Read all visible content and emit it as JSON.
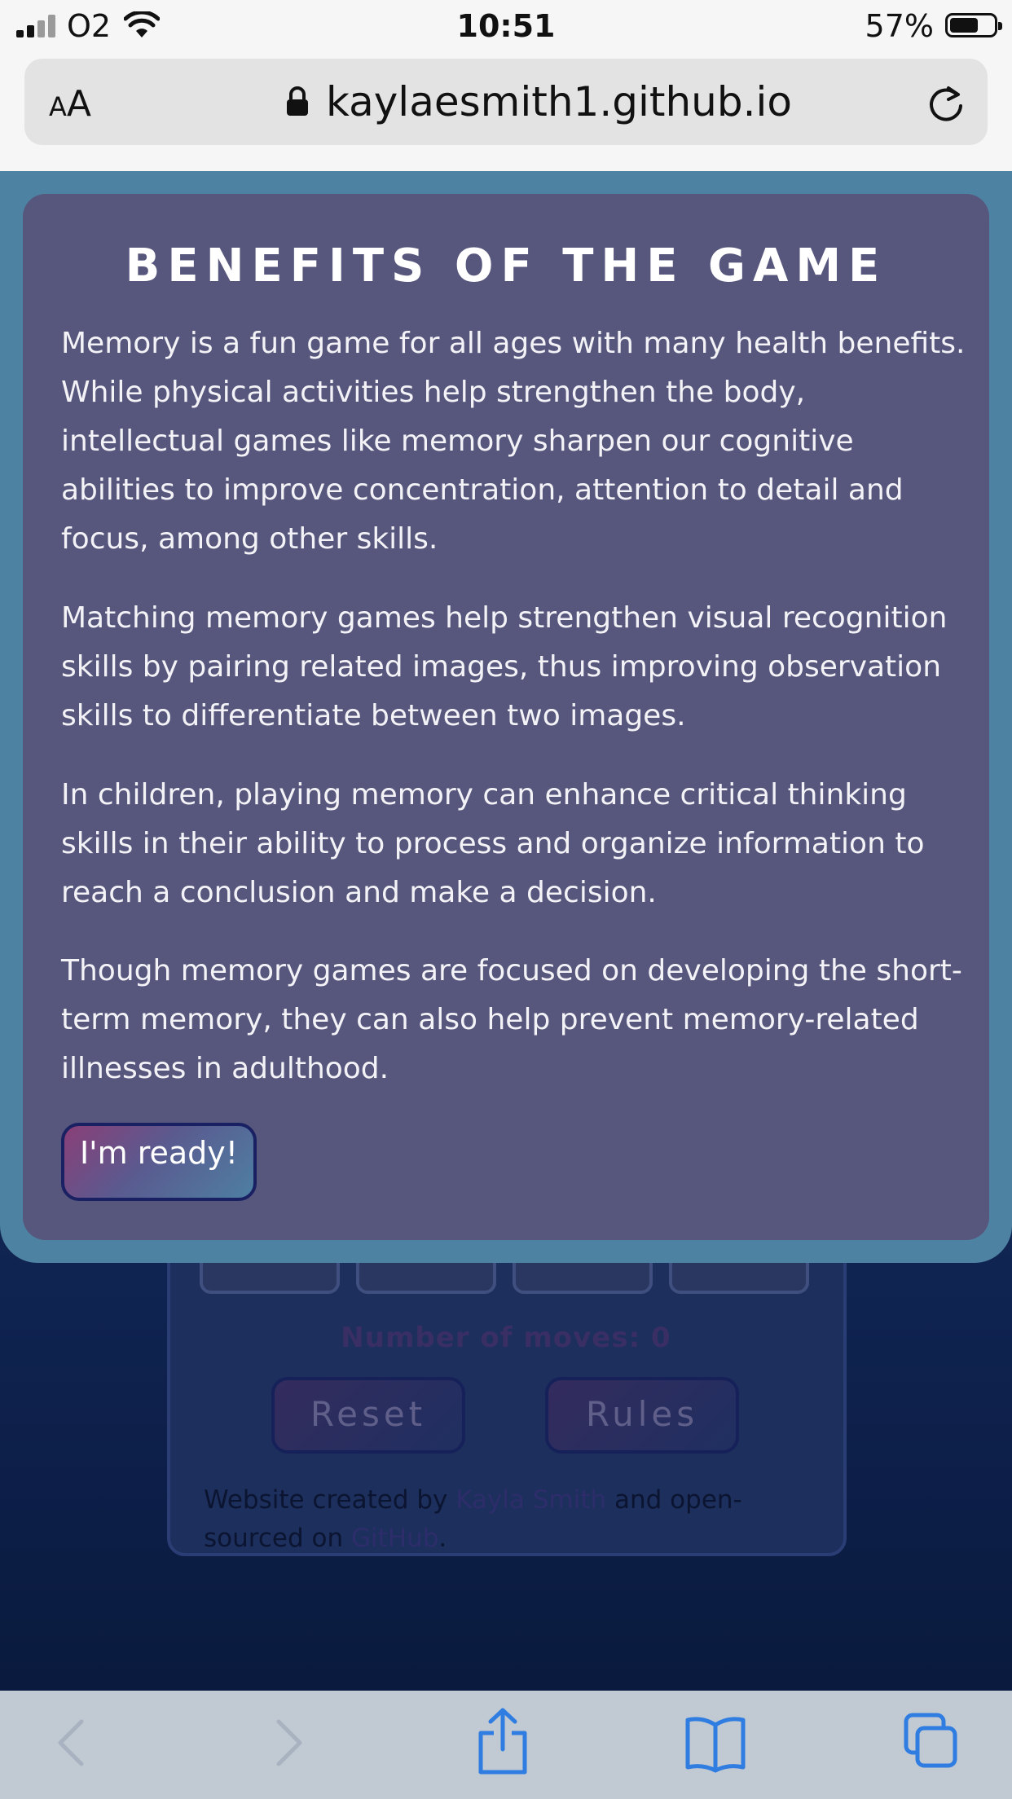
{
  "status_bar": {
    "carrier": "O2",
    "time": "10:51",
    "battery": "57%"
  },
  "browser": {
    "text_size_label": "AA",
    "url": "kaylaesmith1.github.io"
  },
  "modal": {
    "title": "BENEFITS OF THE GAME",
    "paragraphs": [
      "Memory is a fun game for all ages with many health benefits. While physical activities help strengthen the body, intellectual games like memory sharpen our cognitive abilities to improve concentration, attention to detail and focus, among other skills.",
      "Matching memory games help strengthen visual recognition skills by pairing related images, thus improving observation skills to differentiate between two images.",
      "In children, playing memory can enhance critical thinking skills in their ability to process and organize information to reach a conclusion and make a decision.",
      "Though memory games are focused on developing the short-term memory, they can also help prevent memory-related illnesses in adulthood."
    ],
    "ready_button": "I'm ready!"
  },
  "game": {
    "moves_label": "Number of moves: 0",
    "reset_button": "Reset",
    "rules_button": "Rules",
    "credit": {
      "prefix": "Website created by ",
      "author_link": "Kayla Smith",
      "middle": " and open-sourced on ",
      "github_link": "GitHub",
      "suffix": "."
    }
  },
  "toolbar": {
    "icons": [
      "back-icon",
      "forward-icon",
      "share-icon",
      "bookmarks-icon",
      "tabs-icon"
    ]
  },
  "colors": {
    "modal_border": "#4e82a2",
    "modal_background": "#57567c",
    "toolbar_icon_active": "#2f7de1"
  }
}
